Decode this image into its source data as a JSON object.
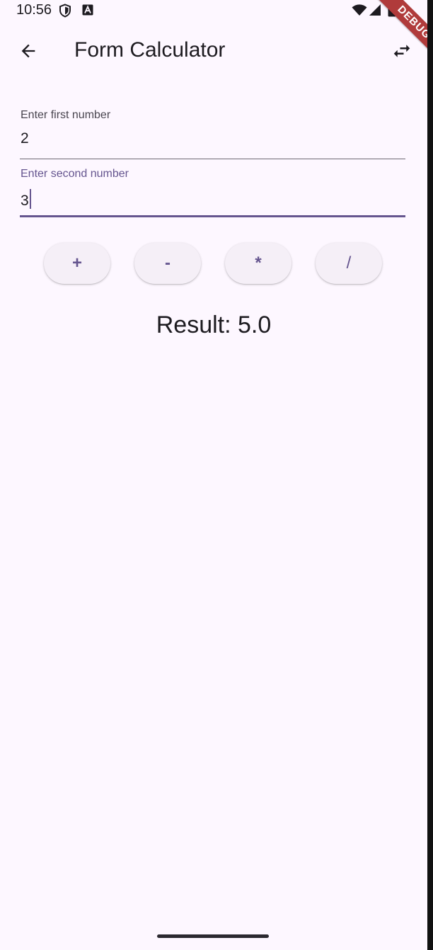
{
  "status_bar": {
    "time": "10:56"
  },
  "debug_banner": "DEBUG",
  "app_bar": {
    "title": "Form Calculator"
  },
  "form": {
    "first_field": {
      "label": "Enter first number",
      "value": "2"
    },
    "second_field": {
      "label": "Enter second number",
      "value": "3"
    }
  },
  "operators": {
    "add": "+",
    "subtract": "-",
    "multiply": "*",
    "divide": "/"
  },
  "result_text": "Result: 5.0",
  "colors": {
    "background": "#fdf7ff",
    "accent": "#65558f",
    "button_surface": "#f5eff7",
    "text": "#1d1b20",
    "debug_banner": "#b03b3b"
  },
  "icons": {
    "back": "arrow-back-icon",
    "swap": "swap-horiz-icon",
    "status_privacy": "shield-icon",
    "status_app": "text-a-icon",
    "status_wifi": "wifi-icon",
    "status_signal": "cell-signal-icon",
    "status_battery": "battery-icon"
  }
}
